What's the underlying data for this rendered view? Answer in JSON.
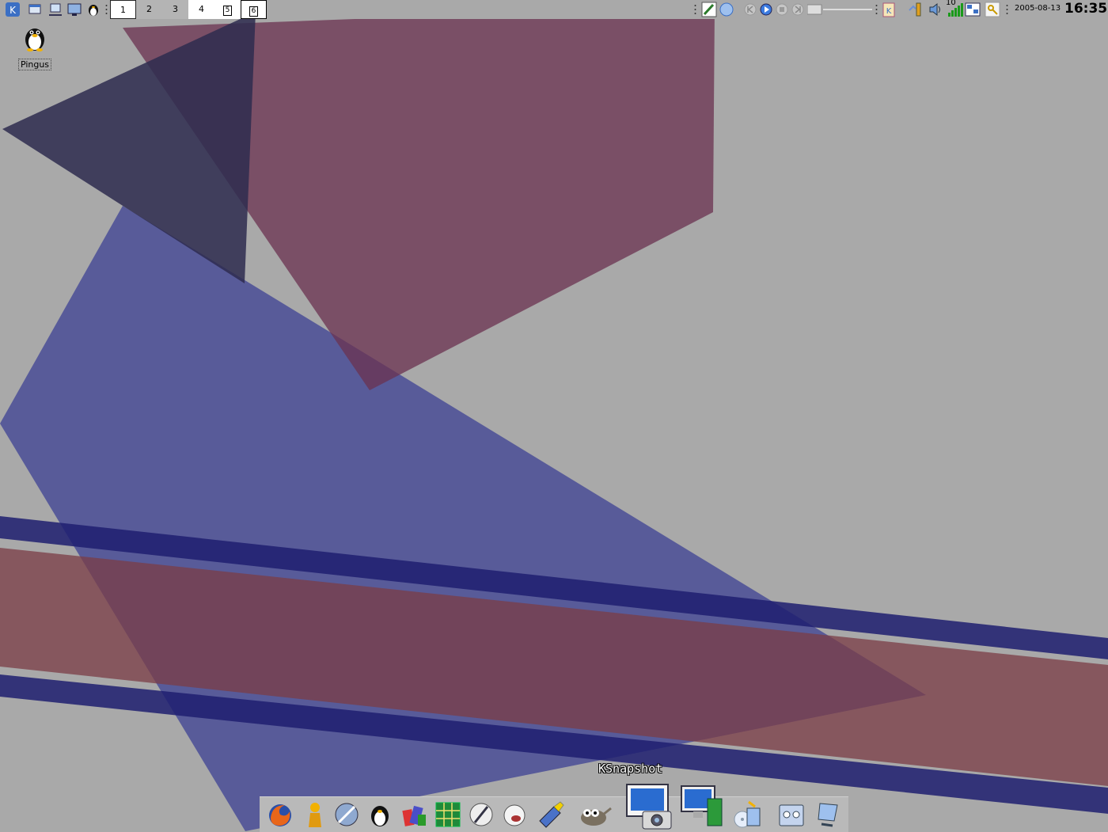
{
  "desktop": {
    "background_color": "#a9a9a9",
    "icons": [
      {
        "label": "Pingus",
        "icon": "penguin-icon"
      }
    ]
  },
  "top_panel": {
    "launchers": [
      "kde-menu-icon",
      "window-list-icon",
      "network-icon",
      "screen-icon",
      "penguin-icon"
    ],
    "pager": [
      "1",
      "2",
      "3",
      "4",
      "5",
      "6"
    ],
    "active_desktop": "1",
    "tray": [
      "pen-icon",
      "blue-orb-icon",
      "prev-icon",
      "play-icon",
      "stop-icon",
      "next-icon",
      "slider-icon",
      "klipper-icon",
      "battery-icon",
      "volume-icon",
      "wifi-signal-icon",
      "network-monitor-icon",
      "keys-icon"
    ],
    "network_count": "10",
    "date": "2005-08-13",
    "time": "16:35"
  },
  "dock": {
    "tooltip": "KSnapshot",
    "apps": [
      "firefox-icon",
      "person-icon",
      "browser-icon",
      "tux-icon",
      "puzzle-icon",
      "sudoku-icon",
      "pen-icon",
      "media-icon",
      "ruler-icon",
      "gimp-icon",
      "ksnapshot-icon",
      "monitor-icon",
      "cd-box-icon",
      "network-settings-icon",
      "computer-icon"
    ]
  }
}
